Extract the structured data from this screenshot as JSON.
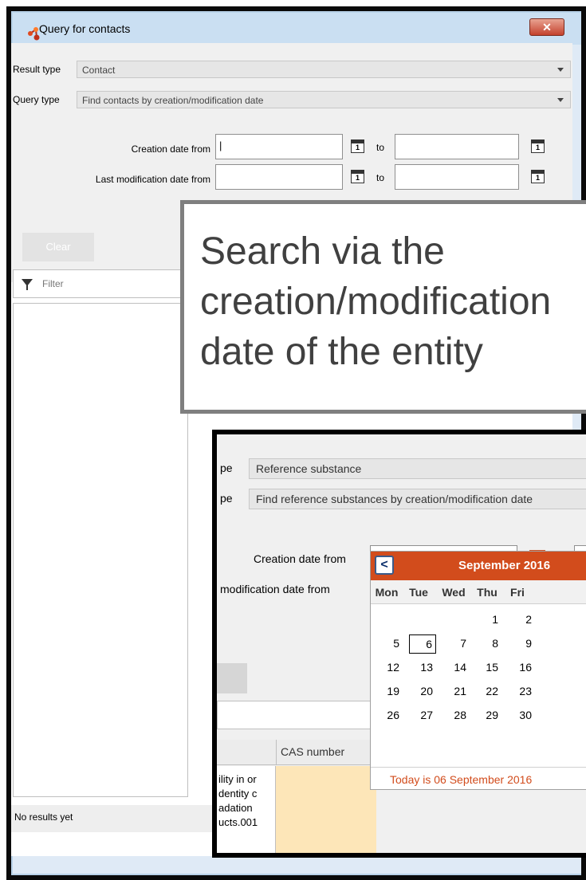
{
  "dialog": {
    "title": "Query for contacts",
    "close_label": "✕",
    "result_type_label": "Result type",
    "result_type_value": "Contact",
    "query_type_label": "Query type",
    "query_type_value": "Find contacts by creation/modification date",
    "creation_from_label": "Creation date from",
    "creation_from_value": "|",
    "to_label": "to",
    "modified_from_label": "Last modification date from",
    "calendar_day": "1",
    "clear_label": "Clear",
    "filter_label": "Filter",
    "status_text": "No results yet"
  },
  "callout": {
    "line1": "Search via the",
    "line2": "creation/modification",
    "line3": "date of the entity"
  },
  "inset": {
    "result_type_label_fragment": "pe",
    "result_type_value": "Reference substance",
    "query_type_label_fragment": "pe",
    "query_type_value": "Find reference substances by creation/modification date",
    "creation_from_label": "Creation date from",
    "to_label": "to",
    "modified_from_label_fragment": "modification date from",
    "table_column_header": "CAS number",
    "table_cells": [
      "ility in or",
      "dentity c",
      "adation",
      "ucts.001"
    ],
    "calendar": {
      "prev_label": "<",
      "month_label": "September 2016",
      "weekdays": [
        "Mon",
        "Tue",
        "Wed",
        "Thu",
        "Fri"
      ],
      "weeks": [
        [
          "",
          "",
          "",
          "1",
          "2"
        ],
        [
          "5",
          "6",
          "7",
          "8",
          "9"
        ],
        [
          "12",
          "13",
          "14",
          "15",
          "16"
        ],
        [
          "19",
          "20",
          "21",
          "22",
          "23"
        ],
        [
          "26",
          "27",
          "28",
          "29",
          "30"
        ]
      ],
      "selected_day": "6",
      "today_text": "Today is  06 September 2016"
    }
  },
  "colors": {
    "accent_orange": "#d24c1c",
    "window_frame": "#b9d3ea",
    "row_highlight": "#fde6b8"
  }
}
